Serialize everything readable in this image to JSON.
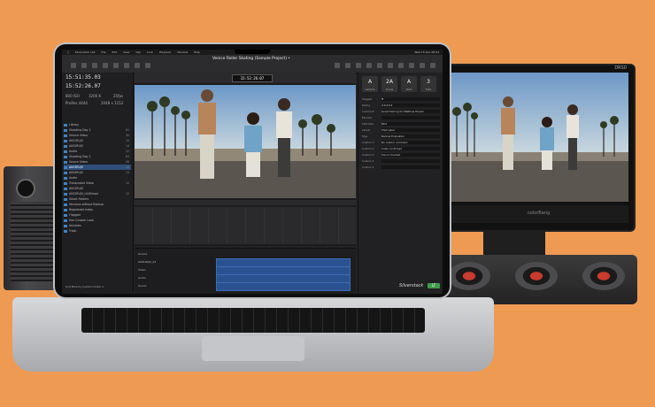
{
  "app": {
    "menu": [
      "Silverstack Lab",
      "File",
      "Edit",
      "View",
      "Clip",
      "Lock",
      "Playback",
      "Window",
      "Help"
    ],
    "menu_right": "Wed 15 Dec 08:54",
    "project_title": "Venice Roller Skating (Sample Project) •",
    "timecode_main": "15:51:35.03",
    "timecode_alt": "15:52:26.07",
    "iso": "800 ISO",
    "wb": "3200 K",
    "fps": "25fps",
    "codec": "ProRes 4444",
    "resolution": "2048 x 1152",
    "viewer_tc": "15:52:26:07",
    "tree": [
      {
        "label": "Library",
        "count": "",
        "sel": false
      },
      {
        "label": "Shooting Day 1",
        "count": "81",
        "sel": false
      },
      {
        "label": "Source Video",
        "count": "40",
        "sel": false
      },
      {
        "label": "A001RUJV",
        "count": "10",
        "sel": false
      },
      {
        "label": "A002RUJV",
        "count": "14",
        "sel": false
      },
      {
        "label": "Audio",
        "count": "12",
        "sel": false
      },
      {
        "label": "Shooting Day 2",
        "count": "63",
        "sel": false
      },
      {
        "label": "Source Video",
        "count": "26",
        "sel": false
      },
      {
        "label": "A003RUJV",
        "count": "12",
        "sel": true
      },
      {
        "label": "A004RUJV",
        "count": "14",
        "sel": false
      },
      {
        "label": "Audio",
        "count": "",
        "sel": false
      },
      {
        "label": "Transcoded Video",
        "count": "10",
        "sel": false
      },
      {
        "label": "A001RUJV",
        "count": "",
        "sel": false
      },
      {
        "label": "A002RUJV_h265mod",
        "count": "12",
        "sel": false
      },
      {
        "label": "Smart Folders",
        "count": "",
        "sel": false
      },
      {
        "label": "Versions without Backup",
        "count": "",
        "sel": false
      },
      {
        "label": "Registered Index",
        "count": "",
        "sel": false
      },
      {
        "label": "Flagged",
        "count": "",
        "sel": false
      },
      {
        "label": "Has Custom Look",
        "count": "",
        "sel": false
      },
      {
        "label": "Volumes",
        "count": "",
        "sel": false
      },
      {
        "label": "Trash",
        "count": "",
        "sel": false
      }
    ],
    "sort_label": "Sort Bins by Custom Order ∨",
    "inspector_tiles": [
      {
        "value": "A",
        "label": "Camera"
      },
      {
        "value": "2A",
        "label": "Scene"
      },
      {
        "value": "A",
        "label": "Shot"
      },
      {
        "value": "3",
        "label": "Take"
      }
    ],
    "inspector_fields": [
      {
        "label": "Flagged",
        "value": "⚑"
      },
      {
        "label": "Rating",
        "value": "★★★★★"
      },
      {
        "label": "Comment",
        "value": "Great framing for Matthias Hausel"
      },
      {
        "label": "Episode",
        "value": ""
      },
      {
        "label": "Shot Size",
        "value": "MCS"
      },
      {
        "label": "Labels",
        "value": "Shot Label"
      },
      {
        "label": "Tags",
        "value": "Backup Evaluation"
      },
      {
        "label": "Custom 1",
        "value": "No custom comment"
      },
      {
        "label": "Custom 2",
        "value": "Audio confirmed"
      },
      {
        "label": "Custom 3",
        "value": "Sound checked"
      },
      {
        "label": "Custom 4",
        "value": ""
      },
      {
        "label": "Custom 5",
        "value": ""
      }
    ],
    "logo": "Silverstack",
    "version": "LT"
  },
  "timeline": {
    "tracks": [
      "Source",
      "A001RUJV_01",
      "Video",
      "Audio",
      "Sound"
    ]
  },
  "monitor": {
    "brand": "DRS0",
    "caption": "colorBang"
  }
}
